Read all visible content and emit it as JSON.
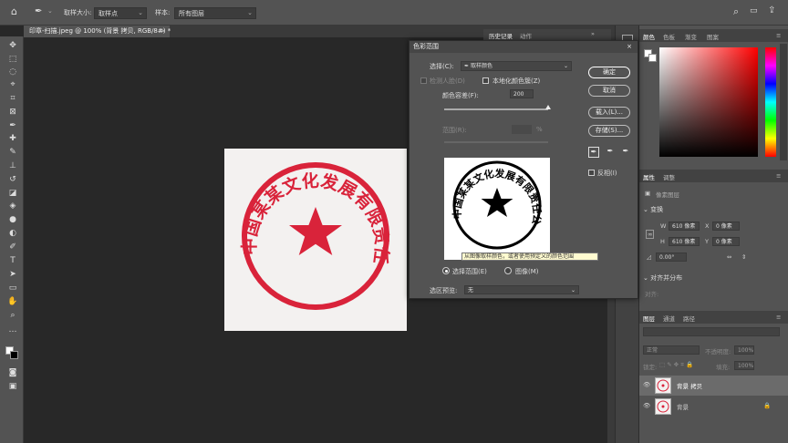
{
  "option_bar": {
    "sample_size_label": "取样大小:",
    "sample_size_value": "取样点",
    "sample_label": "样本:",
    "sample_value": "所有图层"
  },
  "document": {
    "tab_title": "印章-扫描.jpeg @ 100% (背景 拷贝, RGB/8#) *",
    "stamp_text": "中国某某文化发展有限责任公司",
    "stamp_color": "#d9233a"
  },
  "history_panel": {
    "tabs": [
      "历史记录",
      "动作"
    ]
  },
  "dialog": {
    "title": "色彩范围",
    "select_label": "选择(C):",
    "select_value": "取样颜色",
    "detect_faces_label": "检测人脸(D)",
    "localized_label": "本地化颜色簇(Z)",
    "fuzziness_label": "颜色容差(F):",
    "fuzziness_value": "200",
    "fuzziness_fraction": 1.0,
    "range_label": "范围(R):",
    "range_unit": "%",
    "ok_label": "确定",
    "cancel_label": "取消",
    "load_label": "载入(L)...",
    "save_label": "存储(S)...",
    "invert_label": "反相(I)",
    "tooltip": "从图像取样颜色，或者使用预定义的颜色范围",
    "radio_selection_label": "选择范围(E)",
    "radio_image_label": "图像(M)",
    "preview_label": "选区预览:",
    "preview_value": "无"
  },
  "color_panel": {
    "tabs": [
      "颜色",
      "色板",
      "渐变",
      "图案"
    ]
  },
  "properties_panel": {
    "tabs": [
      "属性",
      "调整"
    ],
    "layer_kind": "像素图层",
    "transform_label": "变换",
    "w_label": "W",
    "w_value": "610 像素",
    "h_label": "H",
    "h_value": "610 像素",
    "x_label": "X",
    "x_value": "0 像素",
    "y_label": "Y",
    "y_value": "0 像素",
    "angle_value": "0.00°",
    "align_label": "对齐并分布",
    "align_sub": "对齐:"
  },
  "layers_panel": {
    "tabs": [
      "图层",
      "通道",
      "路径"
    ],
    "blend_mode": "正常",
    "opacity_label": "不透明度:",
    "opacity_value": "100%",
    "lock_label": "锁定:",
    "fill_label": "填充:",
    "fill_value": "100%",
    "layers": [
      {
        "name": "背景 拷贝"
      },
      {
        "name": "背景"
      }
    ]
  }
}
